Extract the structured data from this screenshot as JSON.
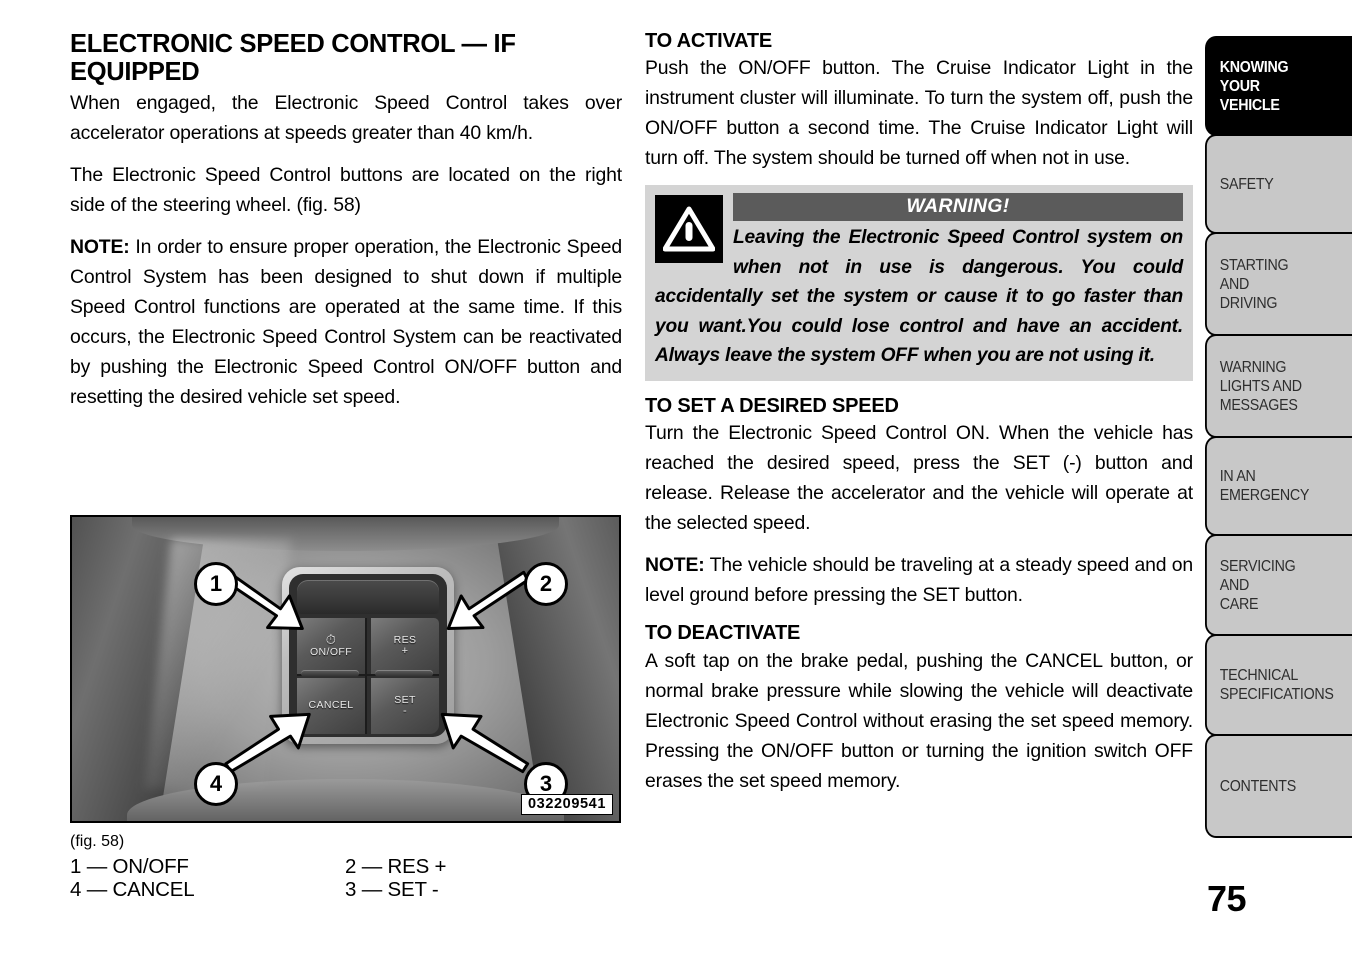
{
  "left_column": {
    "heading": "ELECTRONIC SPEED CONTROL — IF EQUIPPED",
    "paragraph_1": "When engaged, the Electronic Speed Control takes over accelerator operations at speeds greater than 40 km/h.",
    "paragraph_2": "The Electronic Speed Control buttons are located on the right side of the steering wheel. (fig.  58)",
    "note_label": "NOTE:",
    "note_text": "  In order to ensure proper operation, the Electronic Speed Control System has been designed to shut down if multiple Speed Control functions are operated at the same time. If this occurs, the Electronic Speed Control System can be reactivated by pushing the Electronic Speed Control ON/OFF button and resetting the desired vehicle set speed."
  },
  "figure": {
    "caption": "(fig. 58)",
    "image_code": "032209541",
    "buttons": {
      "on_off": "ON/OFF",
      "res": "RES",
      "res_sign": "+",
      "cancel": "CANCEL",
      "set": "SET",
      "set_sign": "-"
    },
    "callouts": [
      "1",
      "2",
      "3",
      "4"
    ],
    "legend": [
      {
        "left": "1 — ON/OFF",
        "right": "2 — RES +"
      },
      {
        "left": "4 — CANCEL",
        "right": "3 — SET -"
      }
    ]
  },
  "right_column": {
    "activate": {
      "heading": "TO ACTIVATE",
      "body": "Push the ON/OFF button. The Cruise Indicator Light in the instrument cluster will illuminate. To turn the system off, push the ON/OFF button a second time. The Cruise Indicator Light will turn off. The system should be turned off when not in use."
    },
    "warning": {
      "title": "WARNING!",
      "icon_name": "warning-triangle-icon",
      "text": "Leaving the Electronic Speed Control system on when not in use is dangerous. You could accidentally set the system or cause it to go faster than you want.You could lose control and have an accident. Always leave the system OFF when you are not using it."
    },
    "set_speed": {
      "heading": "TO SET A DESIRED SPEED",
      "body": "Turn the Electronic Speed Control ON. When the vehicle has reached the desired speed, press the SET (-) button and release. Release the accelerator and the vehicle will operate at the selected speed.",
      "note_label": "NOTE:",
      "note_text": "  The vehicle should be traveling at a steady speed and on level ground before pressing the SET button."
    },
    "deactivate": {
      "heading": "TO DEACTIVATE",
      "body": "A soft tap on the brake pedal, pushing the CANCEL button, or normal brake pressure while slowing the vehicle will deactivate Electronic Speed Control without erasing the set speed memory. Pressing the ON/OFF button or turning the ignition switch OFF erases the set speed memory."
    }
  },
  "sidebar": {
    "tabs": [
      {
        "label": "KNOWING\nYOUR\nVEHICLE",
        "active": true
      },
      {
        "label": "SAFETY",
        "active": false
      },
      {
        "label": "STARTING\nAND\nDRIVING",
        "active": false
      },
      {
        "label": "WARNING\nLIGHTS AND\nMESSAGES",
        "active": false
      },
      {
        "label": "IN AN\nEMERGENCY",
        "active": false
      },
      {
        "label": "SERVICING\nAND\nCARE",
        "active": false
      },
      {
        "label": "TECHNICAL\nSPECIFICATIONS",
        "active": false
      },
      {
        "label": "CONTENTS",
        "active": false
      }
    ]
  },
  "page_number": "75",
  "colors": {
    "tab_gray": "#c8c8c8",
    "tab_active": "#000000",
    "warning_bg": "#d4d4d4",
    "warning_header_bg": "#5b5b5b"
  }
}
